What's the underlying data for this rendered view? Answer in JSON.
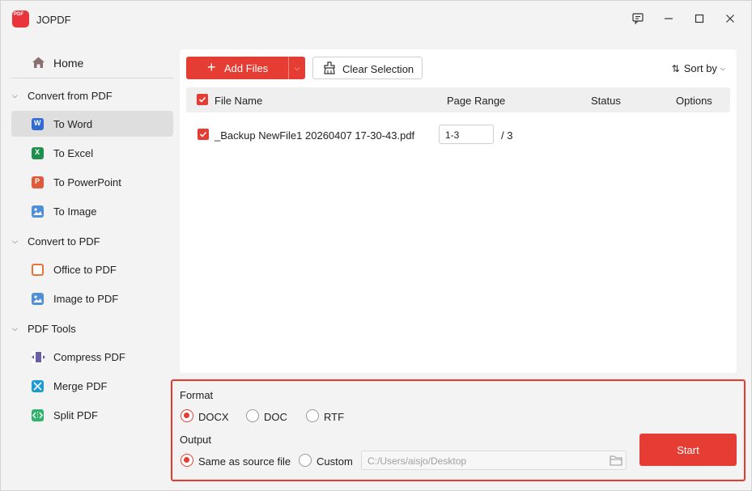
{
  "app": {
    "logo_text": "PDF",
    "title": "JOPDF"
  },
  "window_controls": {
    "feedback": "feedback-icon",
    "minimize": "minimize-icon",
    "maximize": "maximize-icon",
    "close": "close-icon"
  },
  "sidebar": {
    "home": "Home",
    "groups": [
      {
        "label": "Convert from PDF",
        "items": [
          "To Word",
          "To Excel",
          "To PowerPoint",
          "To Image"
        ]
      },
      {
        "label": "Convert to PDF",
        "items": [
          "Office to PDF",
          "Image to PDF"
        ]
      },
      {
        "label": "PDF Tools",
        "items": [
          "Compress PDF",
          "Merge PDF",
          "Split PDF"
        ]
      }
    ],
    "active": "To Word"
  },
  "toolbar": {
    "add_files": "Add Files",
    "clear_selection": "Clear Selection",
    "sort_by": "Sort by"
  },
  "table": {
    "headers": {
      "file_name": "File Name",
      "page_range": "Page Range",
      "status": "Status",
      "options": "Options"
    },
    "rows": [
      {
        "file_name": "_Backup NewFile1 20260407 17-30-43.pdf",
        "page_range": "1-3",
        "total_pages": "/ 3",
        "status": "",
        "checked": true
      }
    ]
  },
  "format": {
    "label": "Format",
    "options": [
      "DOCX",
      "DOC",
      "RTF"
    ],
    "selected": "DOCX"
  },
  "output": {
    "label": "Output",
    "options": [
      "Same as source file",
      "Custom"
    ],
    "selected": "Same as source file",
    "path_placeholder": "C:/Users/aisjo/Desktop"
  },
  "start_button": "Start",
  "colors": {
    "accent": "#e53d34",
    "highlight_border": "#e8392f"
  }
}
